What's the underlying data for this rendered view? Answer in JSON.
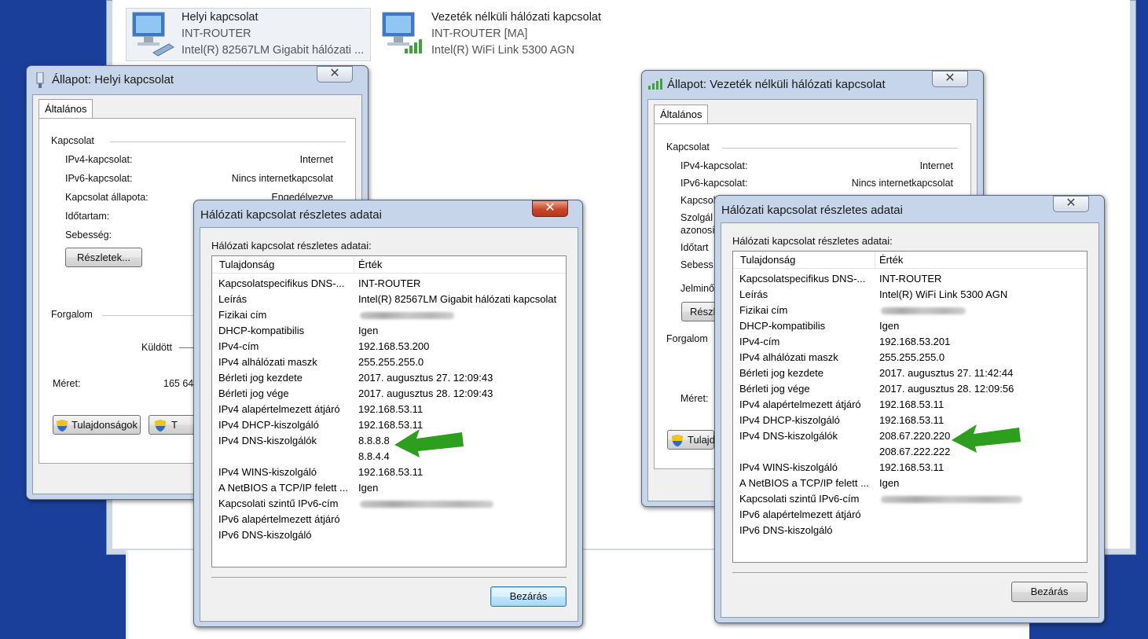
{
  "colors": {
    "desktop": "#1a3f9b",
    "arrow": "#2e9e1e",
    "close_red": "#c9462a"
  },
  "adapters": [
    {
      "name": "Helyi kapcsolat",
      "network": "INT-ROUTER",
      "device": "Intel(R) 82567LM Gigabit hálózati ...",
      "icon": "wired-network-icon"
    },
    {
      "name": "Vezeték nélküli hálózati kapcsolat",
      "network": "INT-ROUTER [MA]",
      "device": "Intel(R)  WiFi Link 5300 AGN",
      "icon": "wireless-network-icon"
    }
  ],
  "status_wired": {
    "title": "Állapot: Helyi kapcsolat",
    "close": "✕",
    "tab": "Általános",
    "section_connection": "Kapcsolat",
    "rows": [
      {
        "label": "IPv4-kapcsolat:",
        "value": "Internet"
      },
      {
        "label": "IPv6-kapcsolat:",
        "value": "Nincs internetkapcsolat"
      },
      {
        "label": "Kapcsolat állapota:",
        "value": "Engedélyezve"
      },
      {
        "label": "Időtartam:",
        "value": ""
      },
      {
        "label": "Sebesség:",
        "value": ""
      }
    ],
    "details_button": "Részletek...",
    "section_traffic": "Forgalom",
    "sent_label": "Küldött",
    "size_label": "Méret:",
    "size_value": "165 64",
    "properties_button": "Tulajdonságok",
    "disable_button": "T"
  },
  "status_wireless": {
    "title": "Állapot: Vezeték nélküli hálózati kapcsolat",
    "close": "✕",
    "tab": "Általános",
    "section_connection": "Kapcsolat",
    "rows": [
      {
        "label": "IPv4-kapcsolat:",
        "value": "Internet"
      },
      {
        "label": "IPv6-kapcsolat:",
        "value": "Nincs internetkapcsolat"
      },
      {
        "label": "Kapcsol",
        "value": ""
      },
      {
        "label": "Szolgál",
        "value": ""
      },
      {
        "label": "azonosí",
        "value": ""
      },
      {
        "label": "Időtart",
        "value": ""
      },
      {
        "label": "Sebess",
        "value": ""
      },
      {
        "label": "Jelminő",
        "value": ""
      }
    ],
    "details_button": "Részl",
    "section_traffic": "Forgalom",
    "size_label": "Méret:",
    "properties_button": "Tulajd"
  },
  "details_wired": {
    "title": "Hálózati kapcsolat részletes adatai",
    "close": "✕",
    "subtitle": "Hálózati kapcsolat részletes adatai:",
    "col_property": "Tulajdonság",
    "col_value": "Érték",
    "rows": [
      {
        "p": "Kapcsolatspecifikus DNS-...",
        "v": "INT-ROUTER"
      },
      {
        "p": "Leírás",
        "v": "Intel(R) 82567LM Gigabit hálózati kapcsolat"
      },
      {
        "p": "Fizikai cím",
        "v": ""
      },
      {
        "p": "DHCP-kompatibilis",
        "v": "Igen"
      },
      {
        "p": "IPv4-cím",
        "v": "192.168.53.200"
      },
      {
        "p": "IPv4 alhálózati maszk",
        "v": "255.255.255.0"
      },
      {
        "p": "Bérleti jog kezdete",
        "v": "2017. augusztus 27. 12:09:43"
      },
      {
        "p": "Bérleti jog vége",
        "v": "2017. augusztus 28. 12:09:43"
      },
      {
        "p": "IPv4 alapértelmezett átjáró",
        "v": "192.168.53.11"
      },
      {
        "p": "IPv4 DHCP-kiszolgáló",
        "v": "192.168.53.11"
      },
      {
        "p": "IPv4 DNS-kiszolgálók",
        "v": "8.8.8.8"
      },
      {
        "p": "",
        "v": "8.8.4.4"
      },
      {
        "p": "IPv4 WINS-kiszolgáló",
        "v": "192.168.53.11"
      },
      {
        "p": "A NetBIOS a TCP/IP felett ...",
        "v": "Igen"
      },
      {
        "p": "Kapcsolati szintű IPv6-cím",
        "v": ""
      },
      {
        "p": "IPv6 alapértelmezett átjáró",
        "v": ""
      },
      {
        "p": "IPv6 DNS-kiszolgáló",
        "v": ""
      }
    ],
    "close_button": "Bezárás"
  },
  "details_wireless": {
    "title": "Hálózati kapcsolat részletes adatai",
    "close": "✕",
    "subtitle": "Hálózati kapcsolat részletes adatai:",
    "col_property": "Tulajdonság",
    "col_value": "Érték",
    "rows": [
      {
        "p": "Kapcsolatspecifikus DNS-...",
        "v": "INT-ROUTER"
      },
      {
        "p": "Leírás",
        "v": "Intel(R)  WiFi Link 5300 AGN"
      },
      {
        "p": "Fizikai cím",
        "v": ""
      },
      {
        "p": "DHCP-kompatibilis",
        "v": "Igen"
      },
      {
        "p": "IPv4-cím",
        "v": "192.168.53.201"
      },
      {
        "p": "IPv4 alhálózati maszk",
        "v": "255.255.255.0"
      },
      {
        "p": "Bérleti jog kezdete",
        "v": "2017. augusztus 27. 11:42:44"
      },
      {
        "p": "Bérleti jog vége",
        "v": "2017. augusztus 28. 12:09:56"
      },
      {
        "p": "IPv4 alapértelmezett átjáró",
        "v": "192.168.53.11"
      },
      {
        "p": "IPv4 DHCP-kiszolgáló",
        "v": "192.168.53.11"
      },
      {
        "p": "IPv4 DNS-kiszolgálók",
        "v": "208.67.220.220"
      },
      {
        "p": "",
        "v": "208.67.222.222"
      },
      {
        "p": "IPv4 WINS-kiszolgáló",
        "v": "192.168.53.11"
      },
      {
        "p": "A NetBIOS a TCP/IP felett ...",
        "v": "Igen"
      },
      {
        "p": "Kapcsolati szintű IPv6-cím",
        "v": ""
      },
      {
        "p": "IPv6 alapértelmezett átjáró",
        "v": ""
      },
      {
        "p": "IPv6 DNS-kiszolgáló",
        "v": ""
      }
    ],
    "close_button": "Bezárás"
  }
}
